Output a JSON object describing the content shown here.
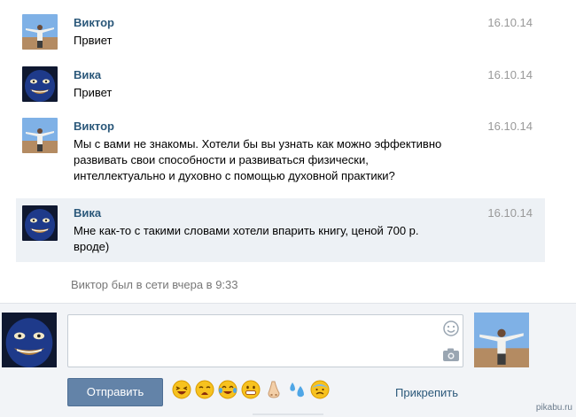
{
  "messages": [
    {
      "sender": "Виктор",
      "date": "16.10.14",
      "lines": [
        "Првиет"
      ]
    },
    {
      "sender": "Вика",
      "date": "16.10.14",
      "lines": [
        "Привет"
      ]
    },
    {
      "sender": "Виктор",
      "date": "16.10.14",
      "lines": [
        "Мы с вами не знакомы. Хотели бы вы узнать как можно эффективно",
        "развивать свои способности и развиваться физически,",
        "интеллектуально и духовно с помощью духовной практики?"
      ]
    },
    {
      "sender": "Вика",
      "date": "16.10.14",
      "lines": [
        "Мне как-то с такими словами хотели впарить книгу, ценой 700 р.",
        "вроде)"
      ]
    }
  ],
  "status": "Виктор был в сети вчера в 9:33",
  "composer": {
    "send_label": "Отправить",
    "attach_label": "Прикрепить",
    "smiley_icon": "smiley-icon",
    "camera_icon": "camera-icon",
    "emojis": [
      "laughing-face",
      "weary-face",
      "tears-of-joy-face",
      "grinning-face",
      "nose",
      "sweat-droplets",
      "cold-sweat-face"
    ]
  },
  "watermark": "pikabu.ru",
  "colors": {
    "sender": "#2b587a",
    "highlight": "#edf1f5",
    "button": "#6383a8"
  }
}
